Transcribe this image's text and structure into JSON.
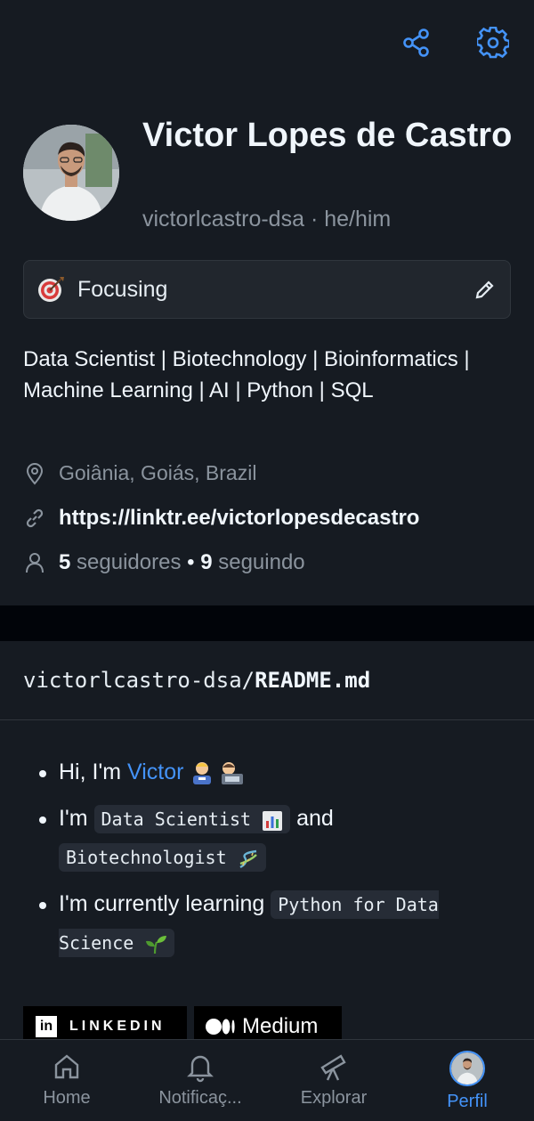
{
  "header": {
    "share_icon": "share-icon",
    "settings_icon": "gear-icon"
  },
  "profile": {
    "name": "Victor Lopes de Castro",
    "handle_line": "victorlcastro-dsa · he/him",
    "status": {
      "emoji": "target-icon",
      "text": "Focusing"
    },
    "bio": "Data Scientist | Biotechnology | Bioinformatics | Machine Learning | AI | Python | SQL",
    "location": "Goiânia, Goiás, Brazil",
    "link": "https://linktr.ee/victorlopesdecastro",
    "followers_count": "5",
    "followers_label": "seguidores",
    "separator": "•",
    "following_count": "9",
    "following_label": "seguindo"
  },
  "readme": {
    "repo": "victorlcastro-dsa/",
    "file": "README.md",
    "items": [
      {
        "prefix": "Hi, I'm ",
        "link": "Victor"
      },
      {
        "prefix": "I'm ",
        "code1": "Data Scientist",
        "mid": " and ",
        "code2": "Biotechnologist"
      },
      {
        "prefix": "I'm currently learning ",
        "code": "Python for Data Science"
      }
    ],
    "badges": {
      "linkedin_letters": "in",
      "linkedin": "LINKEDIN",
      "medium": "Medium"
    }
  },
  "nav": [
    {
      "label": "Home",
      "icon": "home-icon"
    },
    {
      "label": "Notificaç...",
      "icon": "bell-icon"
    },
    {
      "label": "Explorar",
      "icon": "telescope-icon"
    },
    {
      "label": "Perfil",
      "icon": "avatar"
    }
  ],
  "colors": {
    "accent": "#4493f8",
    "background": "#010409",
    "card": "#161b22"
  }
}
